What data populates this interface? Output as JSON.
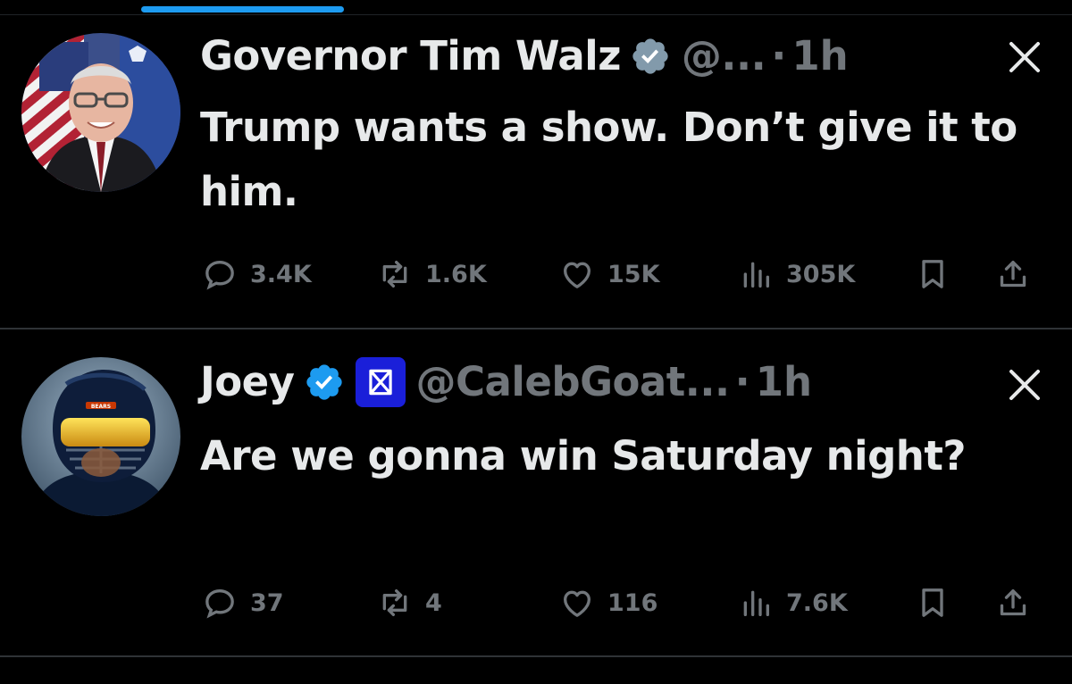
{
  "tweets": [
    {
      "display_name": "Governor Tim Walz",
      "handle": "@...",
      "separator": "·",
      "time": "1h",
      "text": "Trump wants a show. Don’t give it to him.",
      "replies": "3.4K",
      "reposts": "1.6K",
      "likes": "15K",
      "views": "305K"
    },
    {
      "display_name": "Joey",
      "handle": "@CalebGoat...",
      "separator": "·",
      "time": "1h",
      "text": "Are we gonna win Saturday night?",
      "replies": "37",
      "reposts": "4",
      "likes": "116",
      "views": "7.6K"
    }
  ],
  "colors": {
    "background": "#000000",
    "text_primary": "#e7e9ea",
    "text_secondary": "#71767b",
    "accent": "#1d9bf0",
    "divider": "#2f3336",
    "verified_blue": "#1d9bf0",
    "verified_gray": "#829aab"
  },
  "icons": [
    "verified-badge-icon",
    "affiliate-badge-icon",
    "close-x-icon",
    "reply-icon",
    "repost-icon",
    "like-icon",
    "views-icon",
    "bookmark-icon",
    "share-icon"
  ]
}
